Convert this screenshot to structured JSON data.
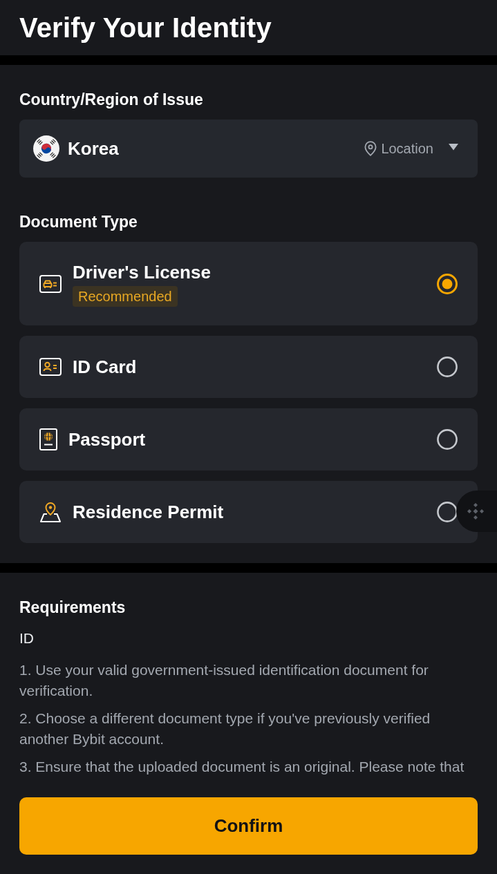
{
  "header": {
    "title": "Verify Your Identity"
  },
  "country": {
    "label": "Country/Region of Issue",
    "value": "Korea",
    "location_label": "Location"
  },
  "document_type": {
    "label": "Document Type",
    "options": [
      {
        "kind": "license",
        "label": "Driver's License",
        "badge": "Recommended",
        "selected": true
      },
      {
        "kind": "card",
        "label": "ID Card",
        "selected": false
      },
      {
        "kind": "passport",
        "label": "Passport",
        "selected": false
      },
      {
        "kind": "permit",
        "label": "Residence Permit",
        "selected": false
      }
    ]
  },
  "requirements": {
    "title": "Requirements",
    "subtitle": "ID",
    "items": [
      "1. Use your valid government-issued identification document for verification.",
      "2. Choose a different document type if you've previously verified another Bybit account.",
      "3. Ensure that the uploaded document is an original. Please note that"
    ]
  },
  "confirm_button": {
    "label": "Confirm"
  }
}
